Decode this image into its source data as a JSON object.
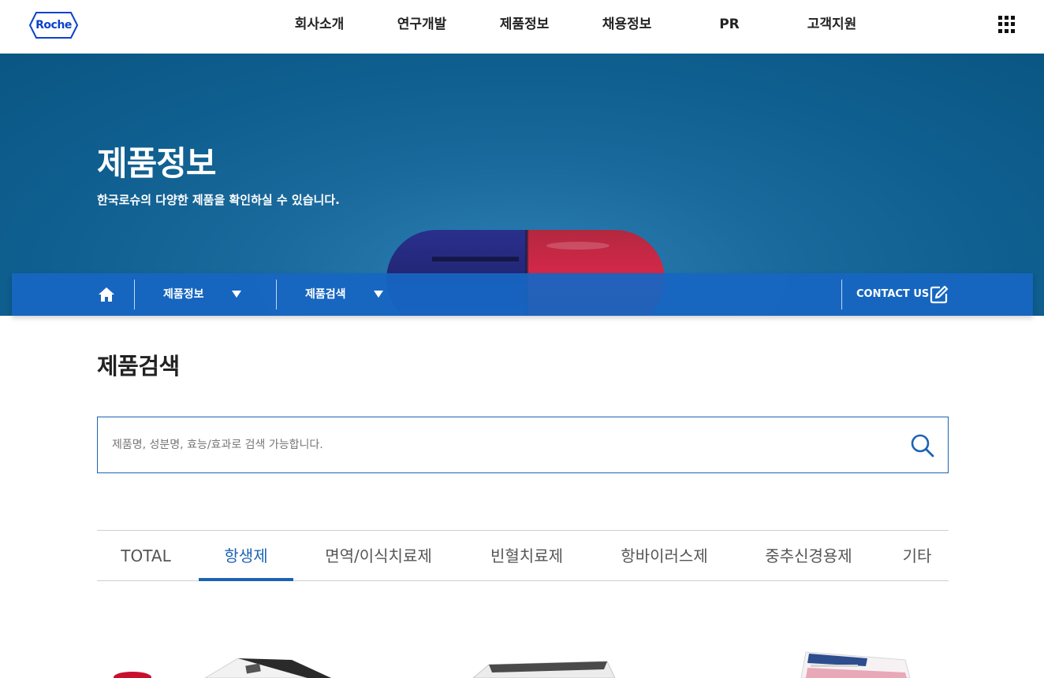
{
  "header": {
    "logo_text": "Roche",
    "nav": [
      "회사소개",
      "연구개발",
      "제품정보",
      "채용정보",
      "PR",
      "고객지원"
    ]
  },
  "hero": {
    "title": "제품정보",
    "subtitle": "한국로슈의 다양한 제품을 확인하실 수 있습니다."
  },
  "subnav": {
    "menu1": "제품정보",
    "menu2": "제품검색",
    "contact": "CONTACT US"
  },
  "main": {
    "title": "제품검색",
    "search_placeholder": "제품명, 성분명, 효능/효과로 검색 가능합니다.",
    "tabs": [
      "TOTAL",
      "항생제",
      "면역/이식치료제",
      "빈혈치료제",
      "항바이러스제",
      "중추신경용제",
      "기타"
    ],
    "active_tab": "항생제"
  },
  "colors": {
    "brand": "#0b41cd",
    "accent": "#1d63b3",
    "subnav": "#1766c3"
  },
  "icons": [
    "roche-logo-icon",
    "grid-menu-icon",
    "home-icon",
    "chevron-down-icon",
    "pencil-icon",
    "search-icon"
  ]
}
